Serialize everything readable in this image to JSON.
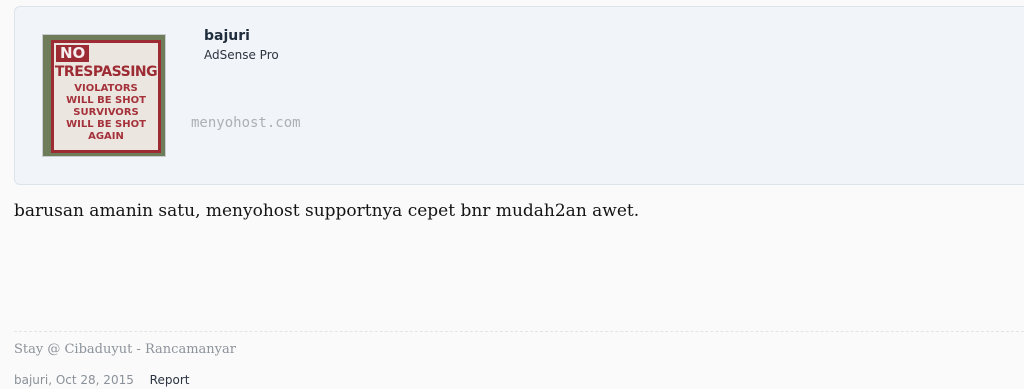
{
  "post": {
    "user": {
      "name": "bajuri",
      "title": "AdSense Pro",
      "avatar_sign": {
        "line1": "NO",
        "line2": "TRESPASSING",
        "line3": "VIOLATORS",
        "line4": "WILL BE SHOT",
        "line5": "SURVIVORS",
        "line6": "WILL BE SHOT",
        "line7": "AGAIN"
      }
    },
    "watermark": "menyohost.com",
    "message": "barusan amanin satu, menyohost supportnya cepet bnr mudah2an awet.",
    "signature": "Stay @ Cibaduyut - Rancamanyar",
    "meta": {
      "author": "bajuri",
      "separator": ",",
      "date": "Oct 28, 2015",
      "report_label": "Report"
    }
  }
}
